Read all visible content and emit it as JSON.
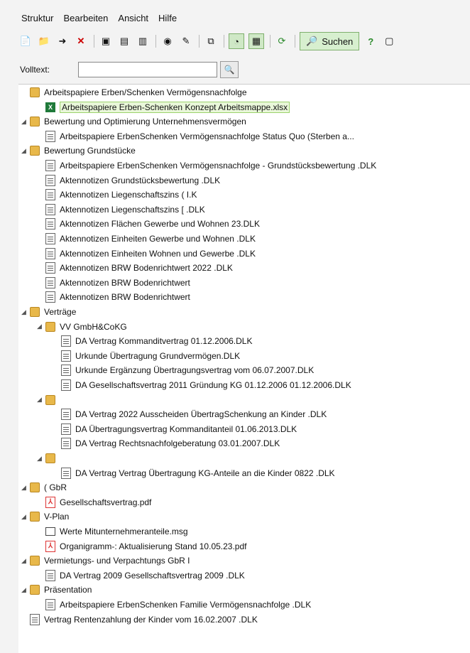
{
  "menu": [
    "Struktur",
    "Bearbeiten",
    "Ansicht",
    "Hilfe"
  ],
  "toolbar": {
    "search_label": "Suchen",
    "icons": [
      "new-icon",
      "new-folder-icon",
      "move-icon",
      "delete-icon",
      "save-icon",
      "save-all-icon",
      "save-as-icon",
      "view-icon",
      "edit-icon",
      "copy-icon",
      "toggle-a-icon",
      "toggle-b-icon",
      "refresh-icon",
      "search-icon",
      "help-icon",
      "extra-icon"
    ]
  },
  "volltext": {
    "label": "Volltext:",
    "value": "",
    "placeholder": ""
  },
  "tree": [
    {
      "level": 0,
      "expander": "",
      "icon": "folder",
      "text": "Arbeitspapiere Erben/Schenken  Vermögensnachfolge"
    },
    {
      "level": 1,
      "expander": "",
      "icon": "xls",
      "text": "Arbeitspapiere Erben-Schenken  Konzept Arbeitsmappe.xlsx",
      "selected": true
    },
    {
      "level": 0,
      "expander": "◢",
      "icon": "folder",
      "text": "Bewertung und Optimierung Unternehmensvermögen"
    },
    {
      "level": 1,
      "expander": "",
      "icon": "doc",
      "text": "Arbeitspapiere ErbenSchenken  Vermögensnachfolge                    Status Quo (Sterben a..."
    },
    {
      "level": 0,
      "expander": "◢",
      "icon": "folder",
      "text": "Bewertung Grundstücke"
    },
    {
      "level": 1,
      "expander": "",
      "icon": "doc",
      "text": "Arbeitspapiere ErbenSchenken  Vermögensnachfolge - Grundstücksbewertung .DLK"
    },
    {
      "level": 1,
      "expander": "",
      "icon": "doc",
      "text": "Aktennotizen  Grundstücksbewertung .DLK"
    },
    {
      "level": 1,
      "expander": "",
      "icon": "doc",
      "text": "Aktennotizen  Liegenschaftszins (           I.K"
    },
    {
      "level": 1,
      "expander": "",
      "icon": "doc",
      "text": "Aktennotizen  Liegenschaftszins [              .DLK"
    },
    {
      "level": 1,
      "expander": "",
      "icon": "doc",
      "text": "Aktennotizen  Flächen Gewerbe und Wohnen                                23.DLK"
    },
    {
      "level": 1,
      "expander": "",
      "icon": "doc",
      "text": "Aktennotizen  Einheiten Gewerbe und Wohnen .DLK"
    },
    {
      "level": 1,
      "expander": "",
      "icon": "doc",
      "text": "Aktennotizen            Einheiten Wohnen und Gewerbe .DLK"
    },
    {
      "level": 1,
      "expander": "",
      "icon": "doc",
      "text": "Aktennotizen  BRW Bodenrichtwert 2022 .DLK"
    },
    {
      "level": 1,
      "expander": "",
      "icon": "doc",
      "text": "Aktennotizen  BRW Bodenrichtwert"
    },
    {
      "level": 1,
      "expander": "",
      "icon": "doc",
      "text": "Aktennotizen  BRW Bodenrichtwert"
    },
    {
      "level": 0,
      "expander": "◢",
      "icon": "folder",
      "text": "Verträge"
    },
    {
      "level": 1,
      "expander": "◢",
      "icon": "folder",
      "text": "VV GmbH&CoKG"
    },
    {
      "level": 2,
      "expander": "",
      "icon": "doc",
      "text": "DA Vertrag  Kommanditvertrag 01.12.2006.DLK"
    },
    {
      "level": 2,
      "expander": "",
      "icon": "doc",
      "text": "Urkunde  Übertragung Grundvermögen.DLK"
    },
    {
      "level": 2,
      "expander": "",
      "icon": "doc",
      "text": "Urkunde  Ergänzung Übertragungsvertrag vom 06.07.2007.DLK"
    },
    {
      "level": 2,
      "expander": "",
      "icon": "doc",
      "text": "DA Gesellschaftsvertrag 2011  Gründung KG 01.12.2006 01.12.2006.DLK"
    },
    {
      "level": 1,
      "expander": "◢",
      "icon": "folder",
      "text": ""
    },
    {
      "level": 2,
      "expander": "",
      "icon": "doc",
      "text": "DA Vertrag 2022 Ausscheiden                              ÜbertragSchenkung an Kinder .DLK"
    },
    {
      "level": 2,
      "expander": "",
      "icon": "doc",
      "text": "DA Übertragungsvertrag  Kommanditanteil  01.06.2013.DLK"
    },
    {
      "level": 2,
      "expander": "",
      "icon": "doc",
      "text": "DA Vertrag   Rechtsnachfolgeberatung 03.01.2007.DLK"
    },
    {
      "level": 1,
      "expander": "◢",
      "icon": "folder",
      "text": ""
    },
    {
      "level": 2,
      "expander": "",
      "icon": "doc",
      "text": "DA Vertrag  Vertrag Übertragung KG-Anteile an die Kinder 0822 .DLK"
    },
    {
      "level": 0,
      "expander": "◢",
      "icon": "folder",
      "text": "(     GbR"
    },
    {
      "level": 1,
      "expander": "",
      "icon": "pdf",
      "text": "Gesellschaftsvertrag.pdf"
    },
    {
      "level": 0,
      "expander": "◢",
      "icon": "folder",
      "text": "V-Plan"
    },
    {
      "level": 1,
      "expander": "",
      "icon": "msg",
      "text": "Werte Mitunternehmeranteile.msg"
    },
    {
      "level": 1,
      "expander": "",
      "icon": "pdf",
      "text": "             Organigramm-:              Aktualisierung Stand 10.05.23.pdf"
    },
    {
      "level": 0,
      "expander": "◢",
      "icon": "folder",
      "text": "Vermietungs- und Verpachtungs GbR I"
    },
    {
      "level": 1,
      "expander": "",
      "icon": "doc",
      "text": "DA Vertrag 2009 Gesellschaftsvertrag 2009 .DLK"
    },
    {
      "level": 0,
      "expander": "◢",
      "icon": "folder",
      "text": "Präsentation"
    },
    {
      "level": 1,
      "expander": "",
      "icon": "doc",
      "text": "Arbeitspapiere ErbenSchenken  Familie                Vermögensnachfolge .DLK"
    },
    {
      "level": 0,
      "expander": "",
      "icon": "doc",
      "text": "Vertrag  Rentenzahlung der Kinder vom 16.02.2007 .DLK"
    }
  ]
}
